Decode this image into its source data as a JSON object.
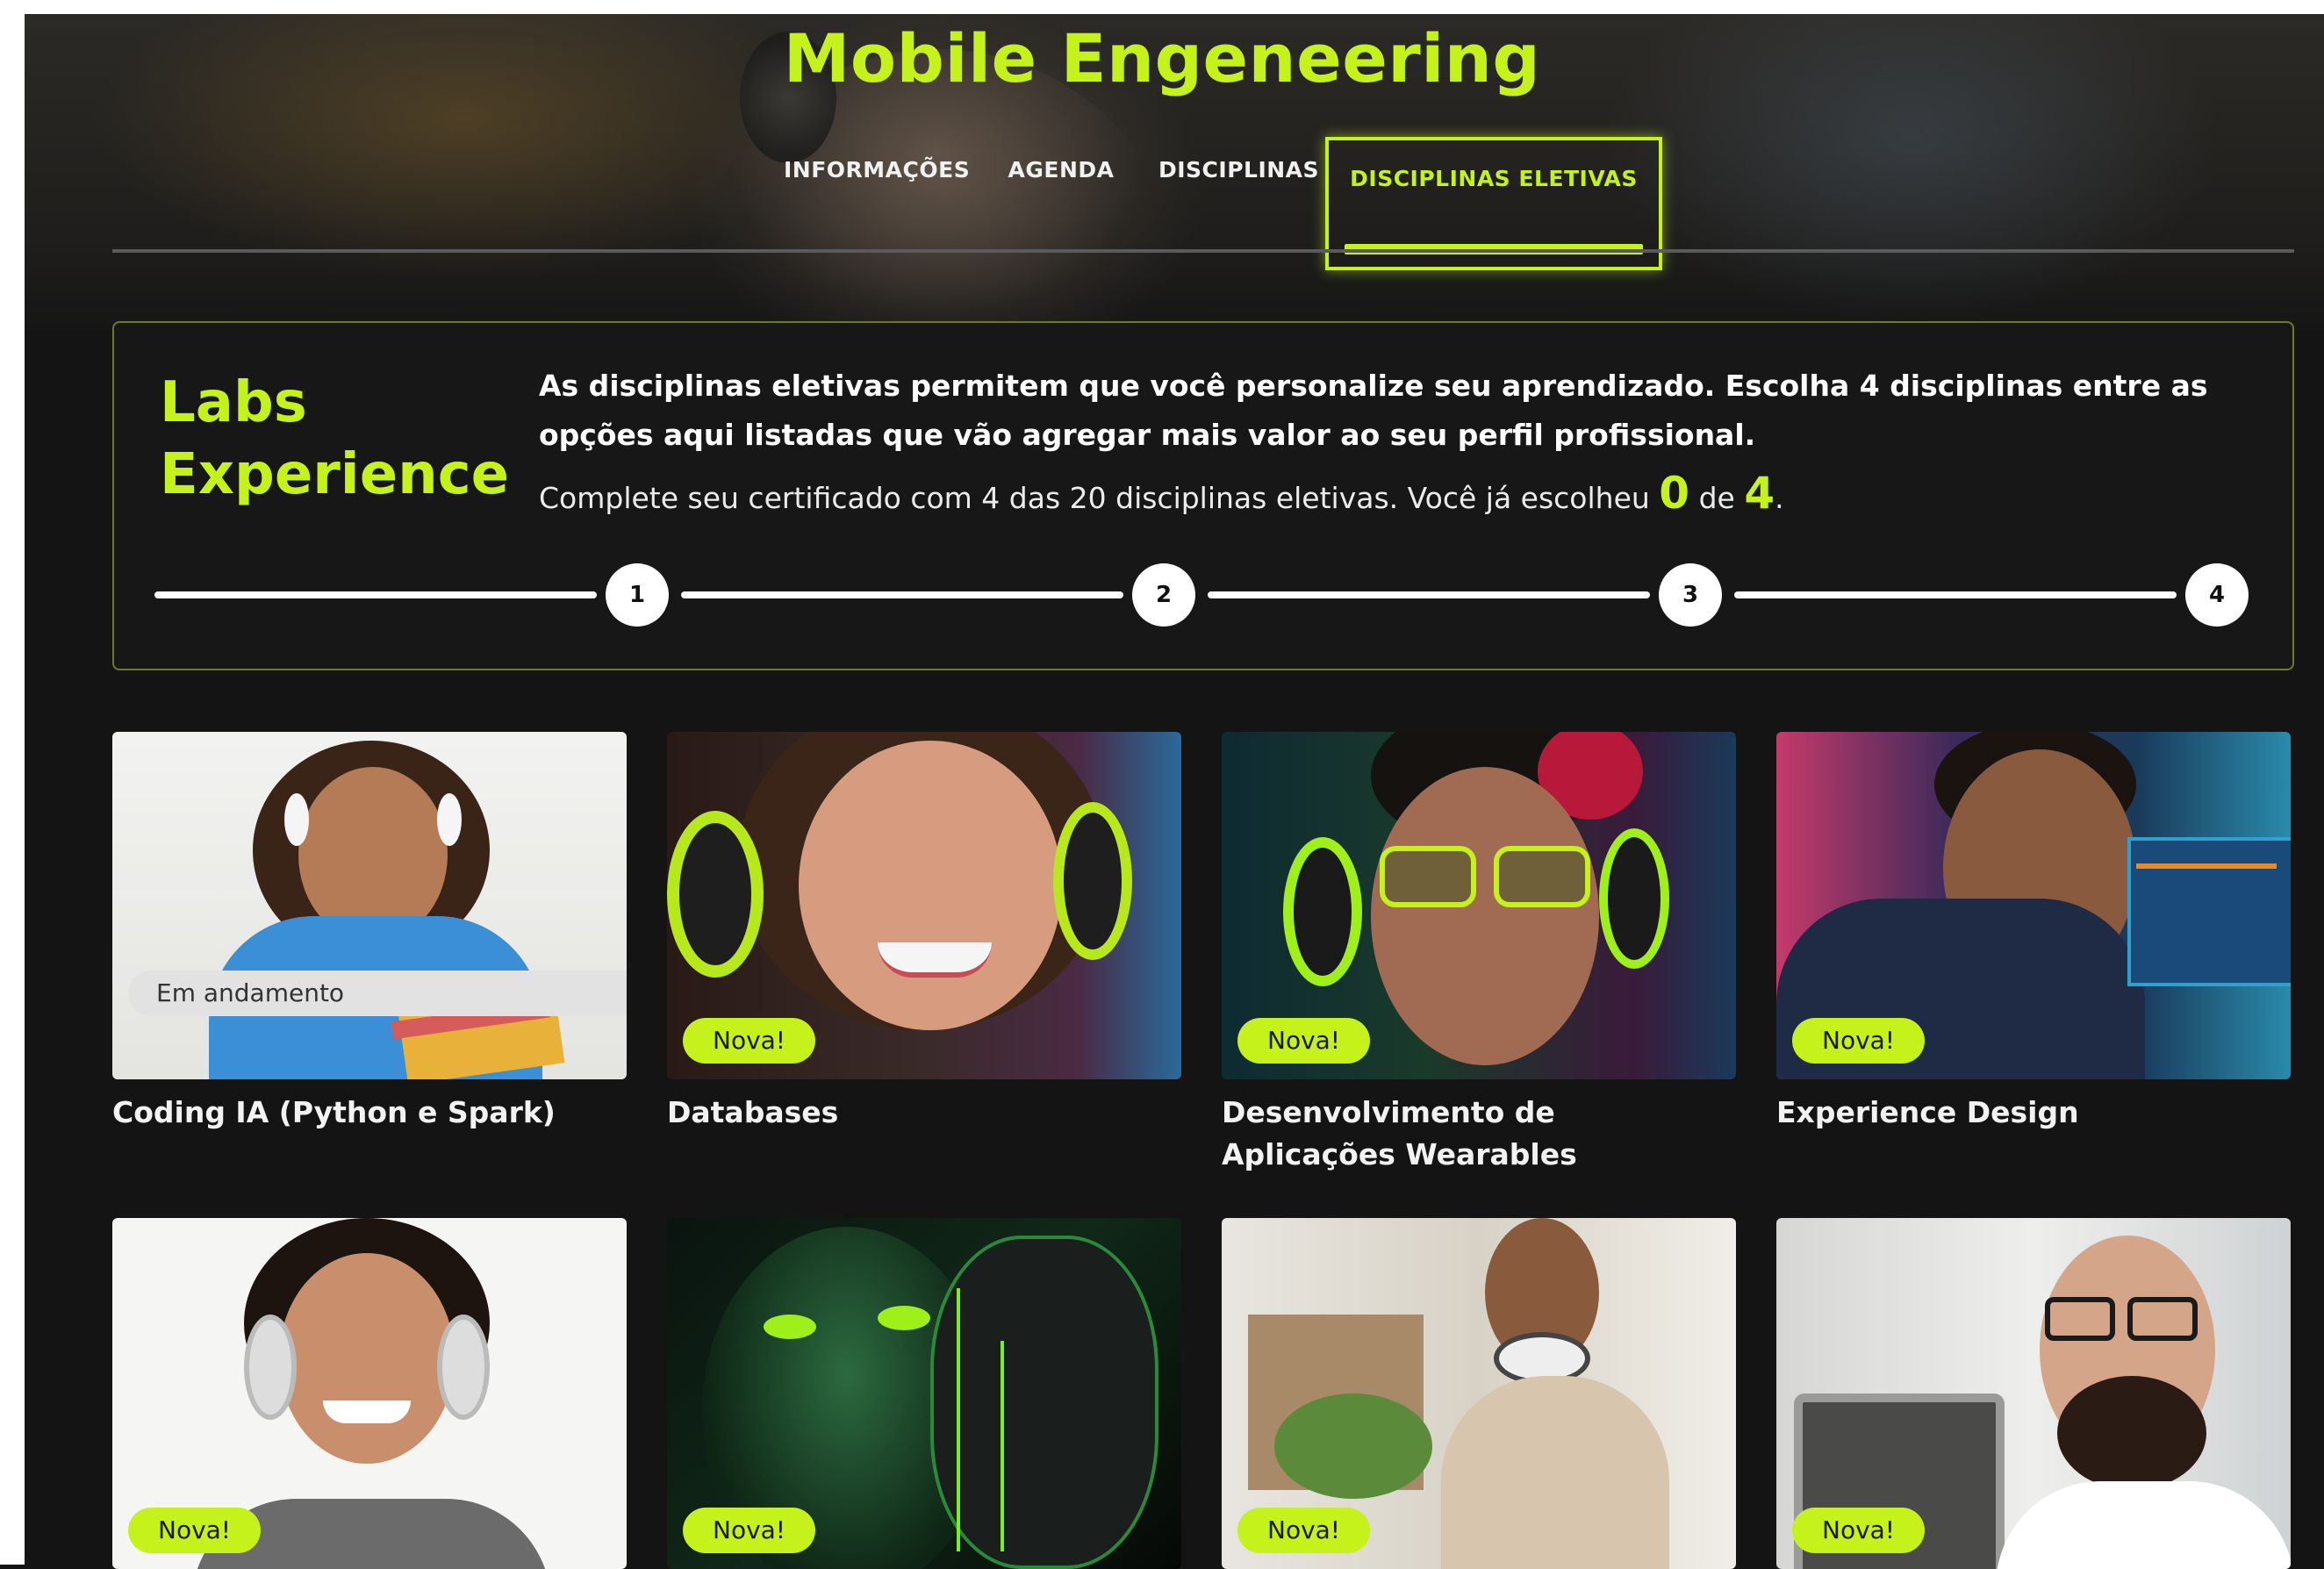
{
  "page": {
    "title": "Mobile Engeneering"
  },
  "tabs": [
    {
      "label": "INFORMAÇÕES",
      "active": false
    },
    {
      "label": "AGENDA",
      "active": false
    },
    {
      "label": "DISCIPLINAS",
      "active": false
    },
    {
      "label": "DISCIPLINAS ELETIVAS",
      "active": true
    }
  ],
  "labs": {
    "title_line1": "Labs",
    "title_line2": "Experience",
    "description": "As disciplinas eletivas permitem que você personalize seu aprendizado. Escolha 4 disciplinas entre as opções aqui listadas que vão agregar mais valor ao seu perfil profissional.",
    "summary_prefix": "Complete seu certificado com 4 das 20 disciplinas eletivas. Você já escolheu",
    "chosen": "0",
    "summary_mid": "de",
    "required": "4",
    "summary_suffix": ".",
    "steps": [
      "1",
      "2",
      "3",
      "4"
    ]
  },
  "colors": {
    "accent": "#c5f21a",
    "background": "#141414"
  },
  "cards": [
    {
      "title": "Coding IA (Python e Spark)",
      "badge": "Em andamento",
      "badge_type": "progress"
    },
    {
      "title": "Databases",
      "badge": "Nova!",
      "badge_type": "new"
    },
    {
      "title": "Desenvolvimento de Aplicações Wearables",
      "badge": "Nova!",
      "badge_type": "new"
    },
    {
      "title": "Experience Design",
      "badge": "Nova!",
      "badge_type": "new"
    },
    {
      "title": "",
      "badge": "Nova!",
      "badge_type": "new"
    },
    {
      "title": "",
      "badge": "Nova!",
      "badge_type": "new"
    },
    {
      "title": "",
      "badge": "Nova!",
      "badge_type": "new"
    },
    {
      "title": "",
      "badge": "Nova!",
      "badge_type": "new"
    }
  ]
}
